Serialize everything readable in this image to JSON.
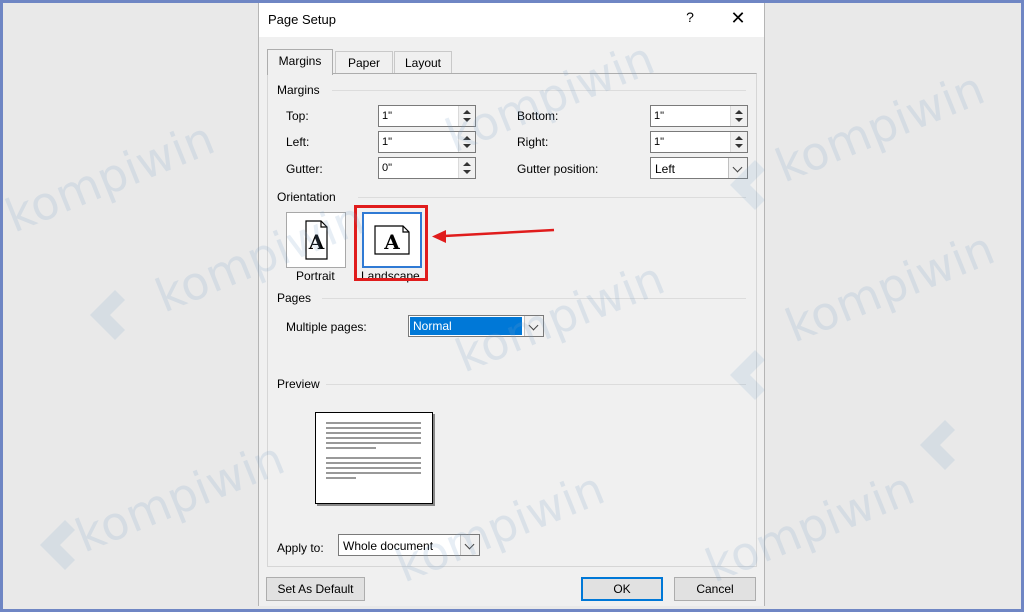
{
  "dialog": {
    "title": "Page Setup",
    "help_label": "?",
    "close_label": "✕"
  },
  "tabs": [
    {
      "label": "Margins"
    },
    {
      "label": "Paper"
    },
    {
      "label": "Layout"
    }
  ],
  "margins": {
    "heading": "Margins",
    "top": {
      "label": "Top:",
      "value": "1\""
    },
    "bottom": {
      "label": "Bottom:",
      "value": "1\""
    },
    "left": {
      "label": "Left:",
      "value": "1\""
    },
    "right": {
      "label": "Right:",
      "value": "1\""
    },
    "gutter": {
      "label": "Gutter:",
      "value": "0\""
    },
    "gutter_position": {
      "label": "Gutter position:",
      "value": "Left"
    }
  },
  "orientation": {
    "heading": "Orientation",
    "portrait_label": "Portrait",
    "landscape_label": "Landscape",
    "icon_letter": "A",
    "selected": "Landscape"
  },
  "pages": {
    "heading": "Pages",
    "multiple_label": "Multiple pages:",
    "multiple_value": "Normal"
  },
  "preview": {
    "heading": "Preview"
  },
  "apply": {
    "label": "Apply to:",
    "value": "Whole document"
  },
  "footer": {
    "default_label": "Set As Default",
    "ok_label": "OK",
    "cancel_label": "Cancel"
  },
  "watermark": {
    "text": "kompiwin"
  },
  "colors": {
    "highlight": "#e01c1c",
    "selection": "#0078d7",
    "frame": "#6f86c4"
  }
}
